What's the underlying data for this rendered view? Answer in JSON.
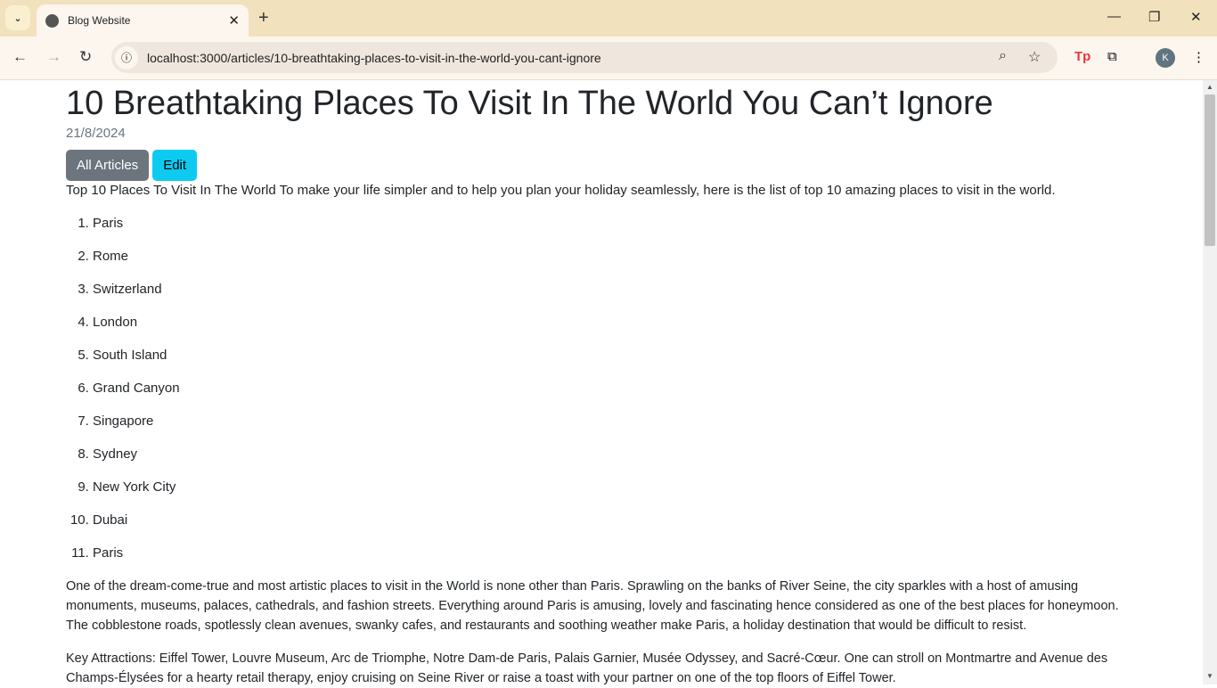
{
  "browser": {
    "tab_title": "Blog Website",
    "url": "localhost:3000/articles/10-breathtaking-places-to-visit-in-the-world-you-cant-ignore",
    "avatar": "K",
    "ext_label": "Tp"
  },
  "article": {
    "title": "10 Breathtaking Places To Visit In The World You Can’t Ignore",
    "date": "21/8/2024",
    "buttons": {
      "all_articles": "All Articles",
      "edit": "Edit"
    },
    "intro": "Top 10 Places To Visit In The World To make your life simpler and to help you plan your holiday seamlessly, here is the list of top 10 amazing places to visit in the world.",
    "list": [
      "Paris",
      "Rome",
      "Switzerland",
      "London",
      "South Island",
      "Grand Canyon",
      "Singapore",
      "Sydney",
      "New York City",
      "Dubai",
      "Paris"
    ],
    "paragraphs": [
      "One of the dream-come-true and most artistic places to visit in the World is none other than Paris. Sprawling on the banks of River Seine, the city sparkles with a host of amusing monuments, museums, palaces, cathedrals, and fashion streets. Everything around Paris is amusing, lovely and fascinating hence considered as one of the best places for honeymoon. The cobblestone roads, spotlessly clean avenues, swanky cafes, and restaurants and soothing weather make Paris, a holiday destination that would be difficult to resist.",
      "Key Attractions: Eiffel Tower, Louvre Museum, Arc de Triomphe, Notre Dam-de Paris, Palais Garnier, Musée Odyssey, and Sacré-Cœur. One can stroll on Montmartre and Avenue des Champs-Élysées for a hearty retail therapy, enjoy cruising on Seine River or raise a toast with your partner on one of the top floors of Eiffel Tower."
    ]
  }
}
